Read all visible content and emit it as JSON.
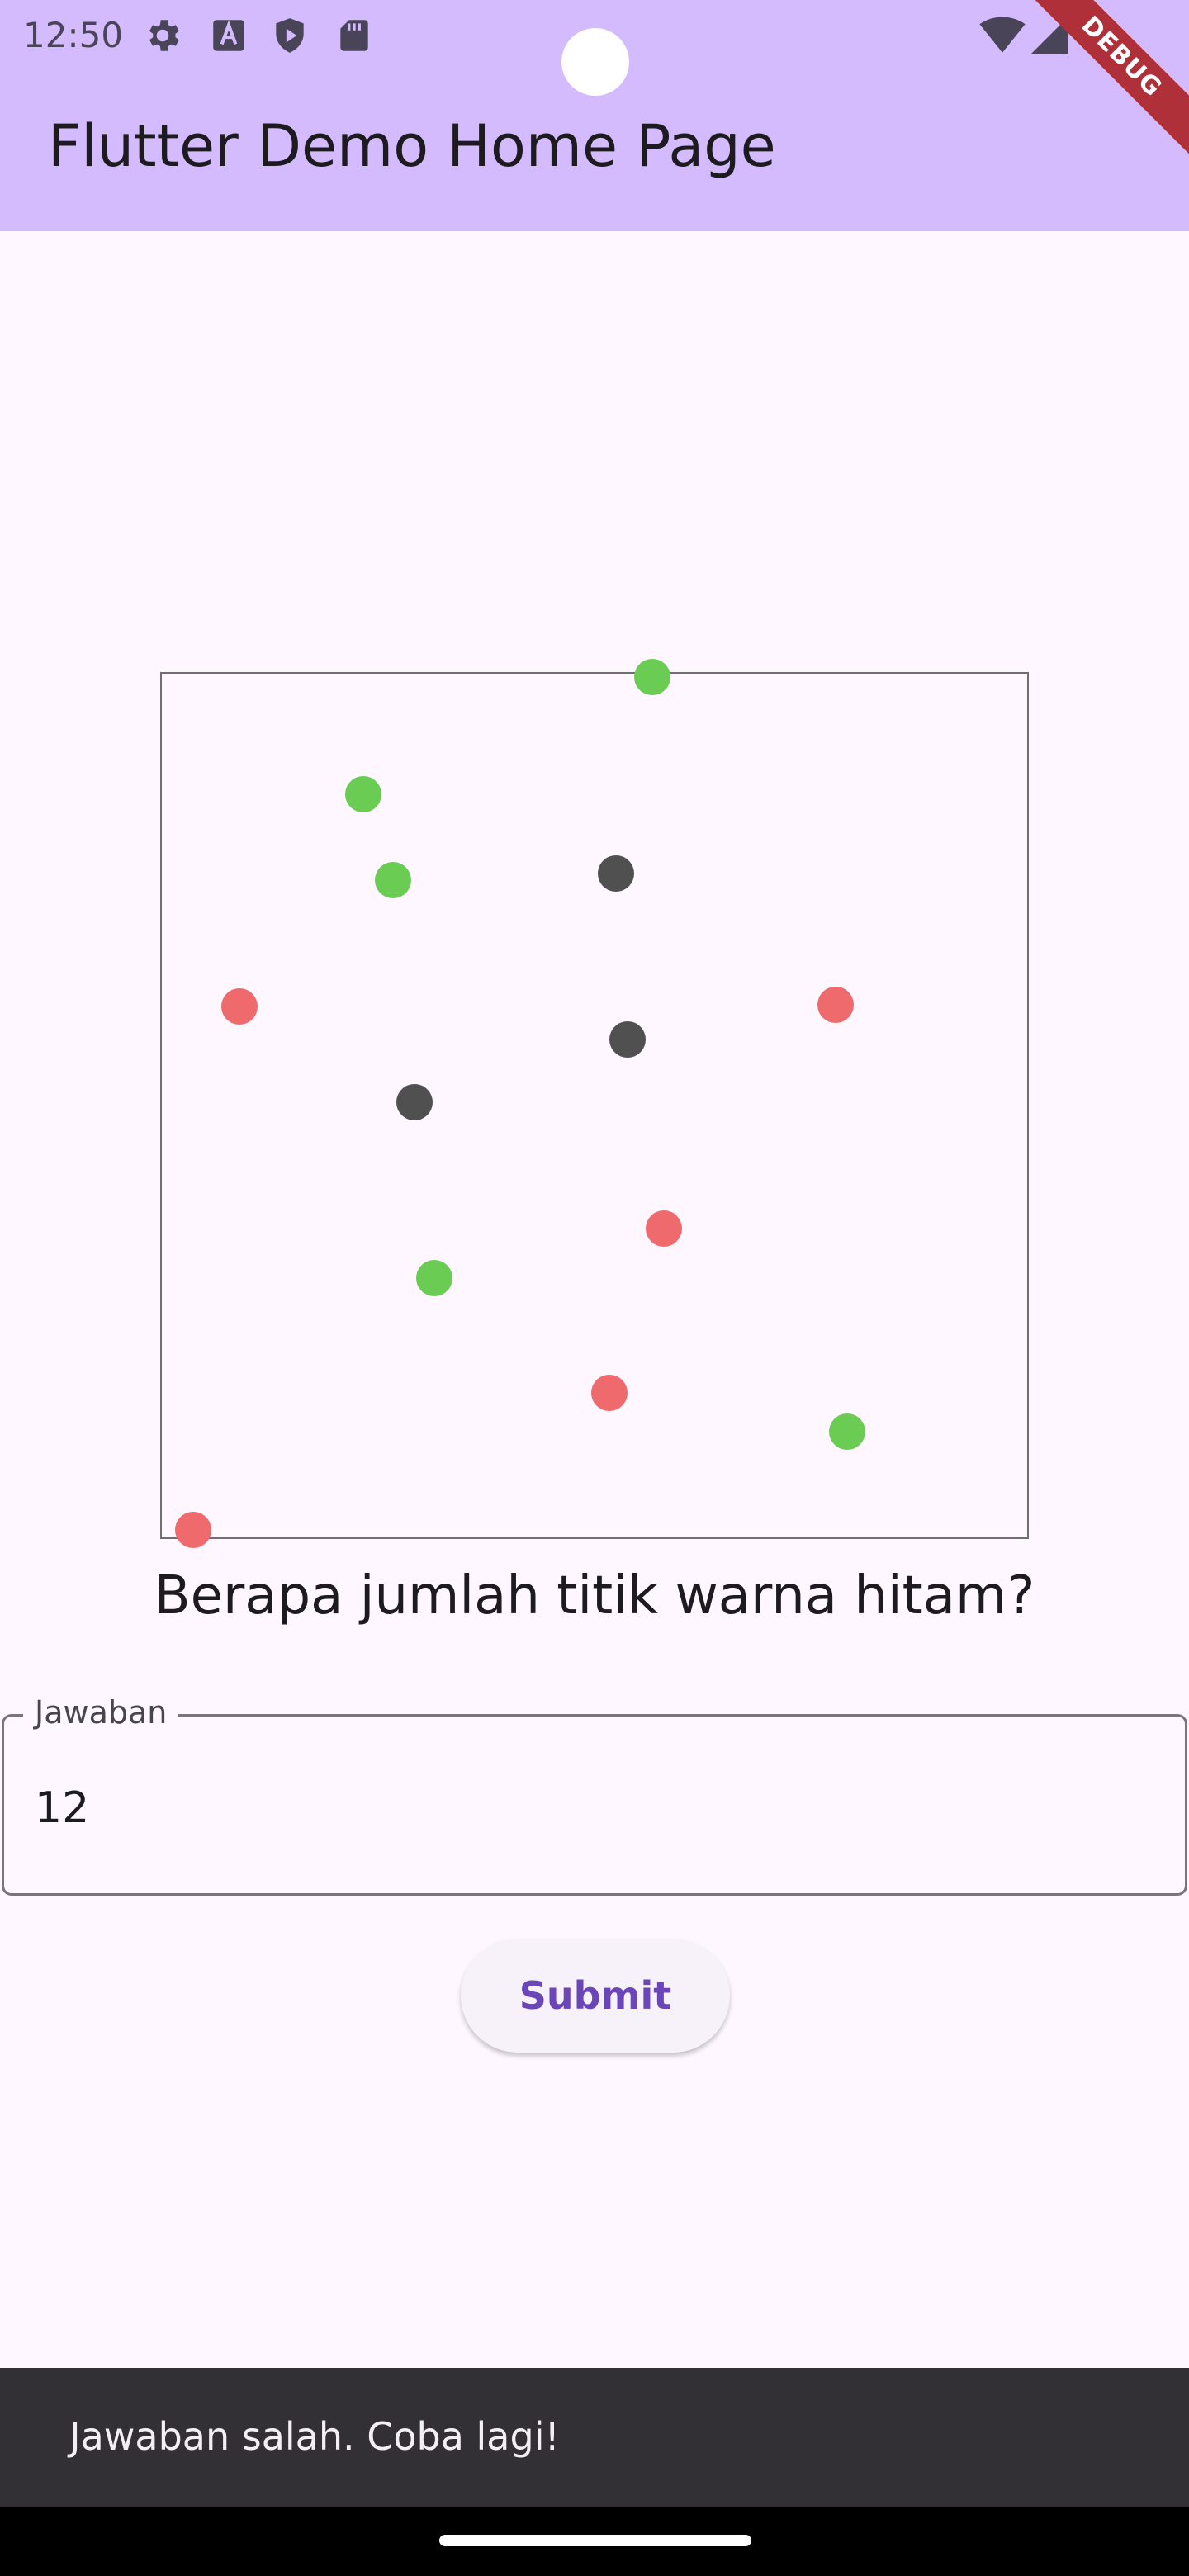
{
  "status_bar": {
    "time": "12:50",
    "left_icons": [
      "gear-icon",
      "font-a-icon",
      "play-protect-icon",
      "sd-card-icon"
    ],
    "right_icons": [
      "wifi-icon",
      "cellular-signal-icon"
    ]
  },
  "app_bar": {
    "title": "Flutter Demo Home Page",
    "color": "#d4bbfe"
  },
  "debug_banner": "DEBUG",
  "board": {
    "colors": {
      "black": "#505050",
      "green": "#6acc53",
      "red": "#ee6a6c"
    },
    "dots": [
      {
        "color": "green"
      },
      {
        "color": "green"
      },
      {
        "color": "green"
      },
      {
        "color": "black"
      },
      {
        "color": "red"
      },
      {
        "color": "red"
      },
      {
        "color": "black"
      },
      {
        "color": "black"
      },
      {
        "color": "red"
      },
      {
        "color": "green"
      },
      {
        "color": "red"
      },
      {
        "color": "green"
      },
      {
        "color": "red"
      }
    ]
  },
  "question": "Berapa jumlah titik warna hitam?",
  "answer_field": {
    "label": "Jawaban",
    "value": "12"
  },
  "submit_label": "Submit",
  "snackbar": "Jawaban salah. Coba lagi!"
}
